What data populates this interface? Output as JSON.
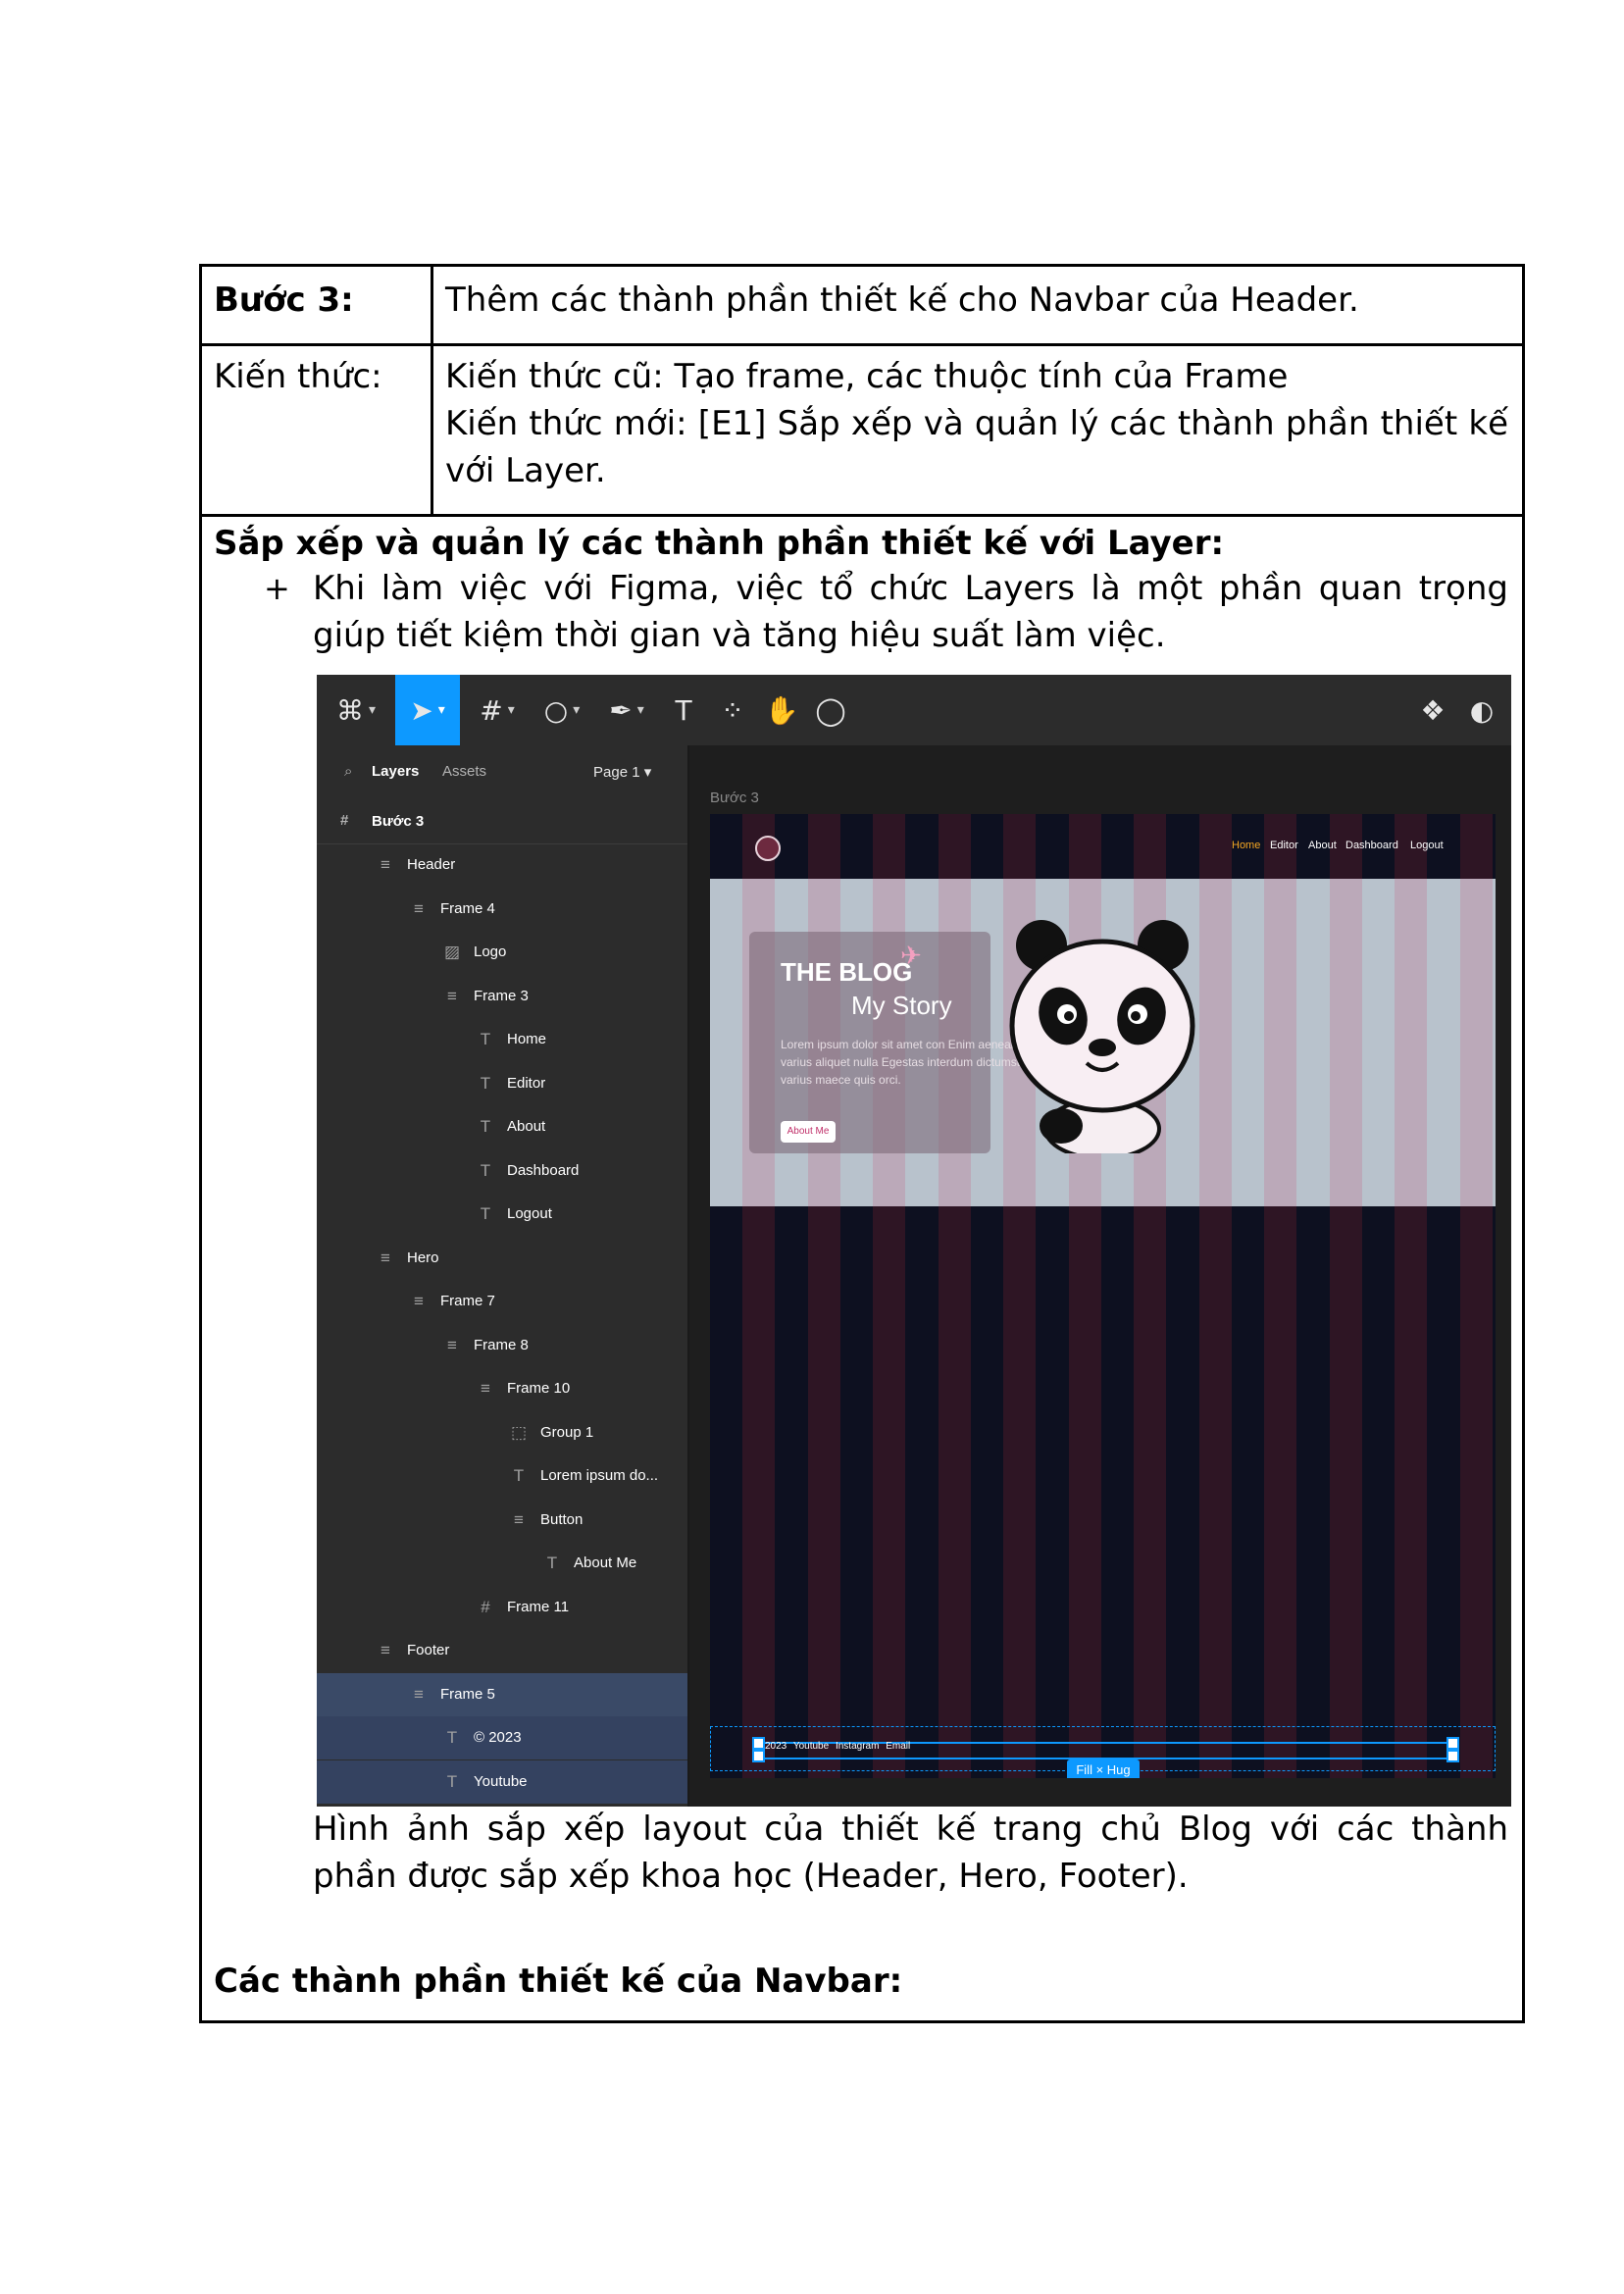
{
  "step": {
    "label": "Bước 3:",
    "title": "Thêm các thành phần thiết kế cho Navbar của Header."
  },
  "knowledge": {
    "label": "Kiến thức:",
    "old": "Kiến thức cũ: Tạo frame, các thuộc tính của Frame",
    "new": "Kiến thức mới: [E1] Sắp xếp và quản lý các thành phần thiết kế với Layer."
  },
  "section": {
    "heading": "Sắp xếp và quản lý các thành phần thiết kế với Layer:",
    "bullet": "+",
    "bullet_text": "Khi làm việc với Figma, việc tổ chức Layers là một phần quan trọng giúp tiết kiệm thời gian và tăng hiệu suất làm việc.",
    "caption": "Hình ảnh sắp xếp layout của thiết kế trang chủ Blog với các thành phần được sắp xếp khoa học (Header, Hero, Footer).",
    "next_heading": "Các thành phần thiết kế của Navbar:"
  },
  "figma": {
    "panel": {
      "tab_layers": "Layers",
      "tab_assets": "Assets",
      "page": "Page 1",
      "page_name": "Bước 3",
      "layers": [
        {
          "label": "Header",
          "icon": "≡"
        },
        {
          "label": "Frame 4",
          "icon": "≡"
        },
        {
          "label": "Logo",
          "icon": "▨"
        },
        {
          "label": "Frame 3",
          "icon": "≡"
        },
        {
          "label": "Home",
          "icon": "T"
        },
        {
          "label": "Editor",
          "icon": "T"
        },
        {
          "label": "About",
          "icon": "T"
        },
        {
          "label": "Dashboard",
          "icon": "T"
        },
        {
          "label": "Logout",
          "icon": "T"
        },
        {
          "label": "Hero",
          "icon": "≡"
        },
        {
          "label": "Frame 7",
          "icon": "≡"
        },
        {
          "label": "Frame 8",
          "icon": "≡"
        },
        {
          "label": "Frame 10",
          "icon": "≡"
        },
        {
          "label": "Group 1",
          "icon": "⬚"
        },
        {
          "label": "Lorem ipsum do...",
          "icon": "T"
        },
        {
          "label": "Button",
          "icon": "≡"
        },
        {
          "label": "About Me",
          "icon": "T"
        },
        {
          "label": "Frame 11",
          "icon": "#"
        },
        {
          "label": "Footer",
          "icon": "≡"
        },
        {
          "label": "Frame 5",
          "icon": "≡"
        },
        {
          "label": "© 2023",
          "icon": "T"
        },
        {
          "label": "Youtube",
          "icon": "T"
        }
      ]
    },
    "canvas": {
      "frame_label": "Bước 3",
      "nav": [
        "Home",
        "Editor",
        "About",
        "Dashboard",
        "Logout"
      ],
      "hero_title": "THE BLOG",
      "hero_subtitle": "My Story",
      "hero_text": "Lorem ipsum dolor sit amet con Enim aenean varius aliquet nulla Egestas interdum dictumst varius maece quis orci.",
      "hero_button": "About Me",
      "footer_text": "2023 Youtube Instagram Email",
      "fill_hug": "Fill × Hug"
    },
    "colors": {
      "accent": "#0d99ff",
      "nav_active": "#f5a623"
    }
  }
}
